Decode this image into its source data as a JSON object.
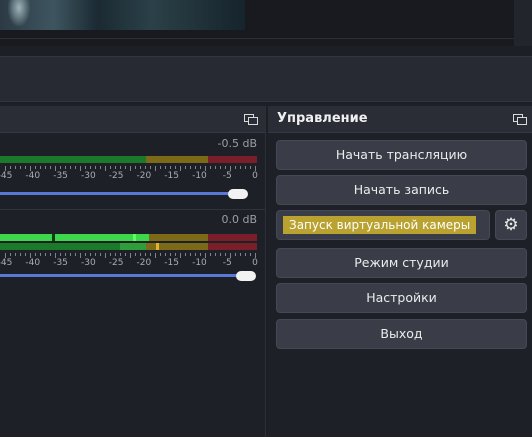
{
  "controls": {
    "title": "Управление",
    "buttons": {
      "start_stream": "Начать трансляцию",
      "start_recording": "Начать запись",
      "start_virtual_camera": "Запуск виртуальной камеры",
      "studio_mode": "Режим студии",
      "settings": "Настройки",
      "exit": "Выход"
    },
    "vcam_settings_icon": "gear-icon"
  },
  "mixer": {
    "dock_icon": "undock-icon",
    "channels": [
      {
        "db": "-0.5 dB",
        "level_percent": 0,
        "volume_percent": 100
      },
      {
        "db": "0.0 dB",
        "level_percent": 58,
        "volume_percent": 100
      }
    ],
    "scale": [
      "-45",
      "-40",
      "-35",
      "-30",
      "-25",
      "-20",
      "-15",
      "-10",
      "-5",
      "0"
    ]
  },
  "colors": {
    "meter_green": "#1b7a29",
    "meter_yellow": "#7d6a18",
    "meter_red": "#7a1e2a",
    "level_active": "#3ed64a",
    "volume_slider": "#5a78d8",
    "vcam_highlight": "#b9a22f"
  }
}
